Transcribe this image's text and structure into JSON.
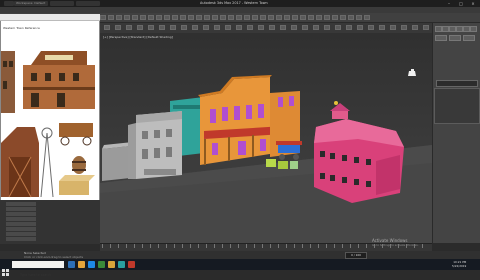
{
  "titlebar": {
    "title": "Autodesk 3ds Max 2017 - Western Town",
    "tabs": [
      "Workspace: Default",
      "",
      ""
    ]
  },
  "menubar": {
    "items": [
      "Edit",
      "Tools",
      "Group",
      "Views",
      "Create",
      "Modifiers",
      "Animation",
      "Graph Editors",
      "Rendering",
      "Civil View",
      "Customize",
      "Scripting",
      "Help"
    ]
  },
  "viewport": {
    "label": "[+] [Perspective] [Standard] [Default Shading]"
  },
  "refpanel": {
    "title": "Western Town Reference"
  },
  "status": {
    "line1": "None Selected",
    "line2": "Click or click-and-drag to select objects",
    "frame": "0 / 100"
  },
  "activate": {
    "title": "Activate Windows",
    "sub": "Go to Settings to activate Windows."
  },
  "taskbar": {
    "search_placeholder": "Type here to search",
    "time": "10:21 PM",
    "date": "5/22/2019"
  },
  "colors": {
    "viewport_bg": "#3e3e3e",
    "saloon": "#e8963a",
    "barn": "#d9417a",
    "saloon_window": "#b04fd0",
    "bank": "#b9b9b9",
    "teal_building": "#2fa39a"
  }
}
